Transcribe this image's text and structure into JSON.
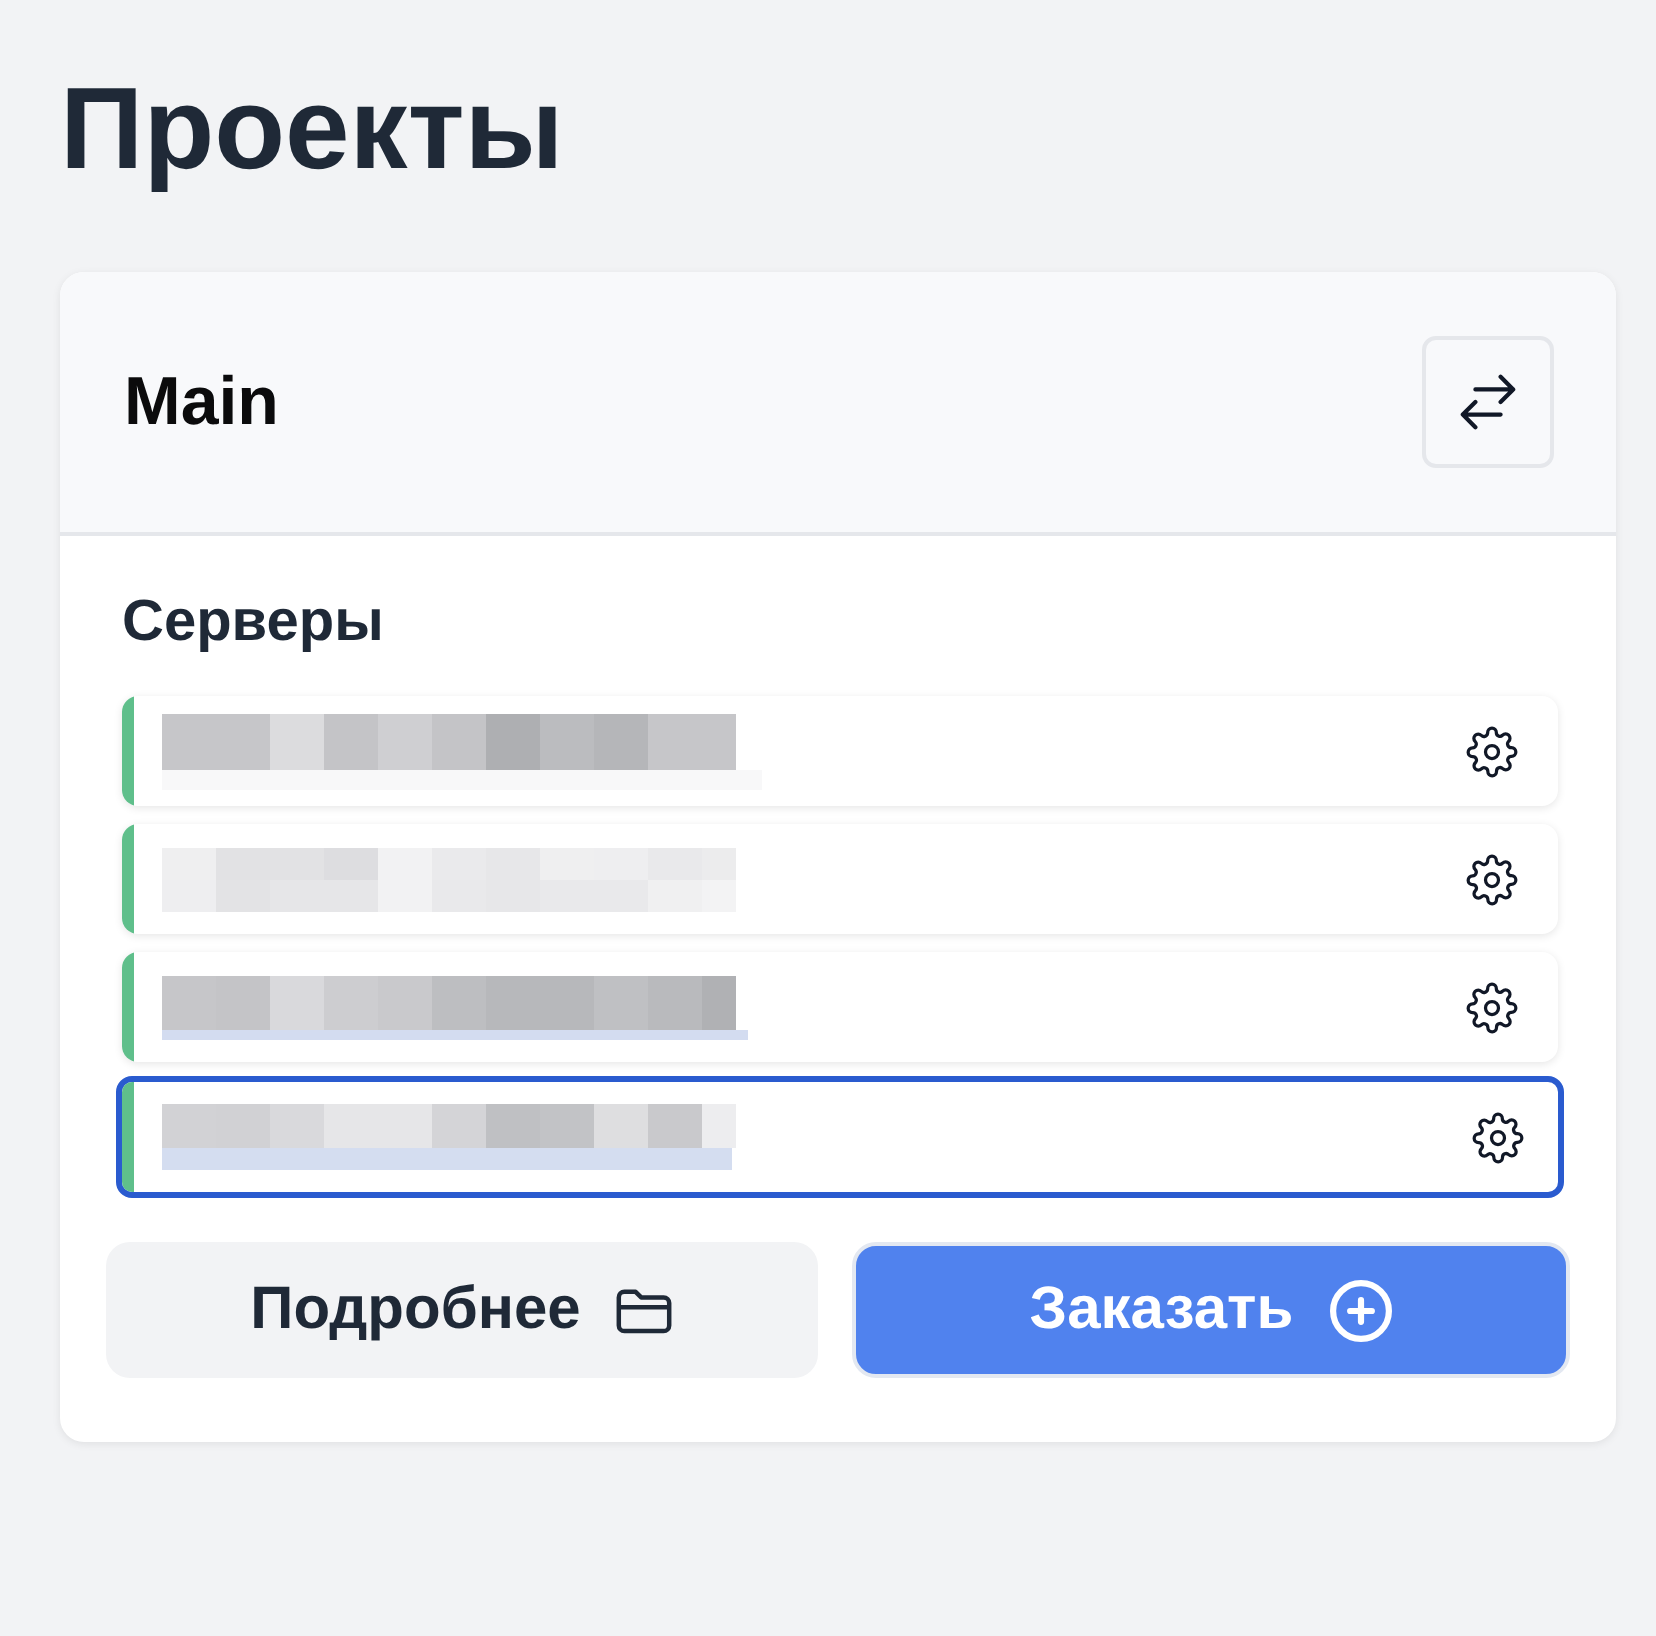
{
  "page": {
    "title": "Проекты"
  },
  "project": {
    "name": "Main"
  },
  "servers": {
    "heading": "Серверы",
    "items": [
      {
        "online": true,
        "selected": false
      },
      {
        "online": true,
        "selected": false
      },
      {
        "online": true,
        "selected": false
      },
      {
        "online": true,
        "selected": true
      }
    ]
  },
  "actions": [
    {
      "kind": "secondary",
      "label": "Подробнее"
    },
    {
      "kind": "primary",
      "label": "Заказать"
    }
  ]
}
